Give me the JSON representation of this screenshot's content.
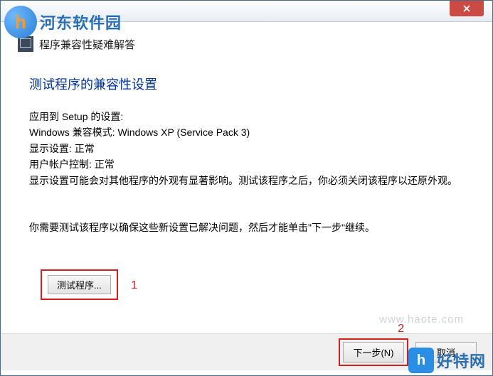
{
  "titlebar": {
    "close_label": "×"
  },
  "header": {
    "title": "程序兼容性疑难解答"
  },
  "section_title": "测试程序的兼容性设置",
  "settings": {
    "applied_to": "应用到 Setup 的设置:",
    "compat_mode": "Windows 兼容模式: Windows XP (Service Pack 3)",
    "display_setting": "显示设置: 正常",
    "uac": "用户帐户控制: 正常",
    "note": "显示设置可能会对其他程序的外观有显著影响。测试该程序之后，你必须关闭该程序以还原外观。"
  },
  "instruction": "你需要测试该程序以确保这些新设置已解决问题，然后才能单击\"下一步\"继续。",
  "buttons": {
    "test": "测试程序...",
    "next": "下一步(N)",
    "cancel": "取消"
  },
  "annotations": {
    "one": "1",
    "two": "2"
  },
  "overlays": {
    "tl_text": "河东软件园",
    "br_text": "好特网",
    "watermark": "www.haote.com"
  }
}
